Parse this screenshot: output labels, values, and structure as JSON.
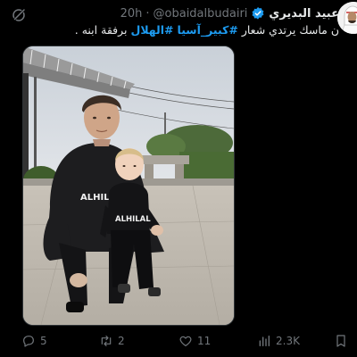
{
  "author": {
    "display_name": "عبيد البديري",
    "handle": "@obaidalbudairi",
    "separator": "·",
    "time": "20h"
  },
  "tweet": {
    "text_before": "ن ماسك يرتدي شعار ",
    "hashtag_1": "#كبير_آسيا",
    "hashtag_2": "#الهلال",
    "text_after": " برفقة ابنه ."
  },
  "media": {
    "shirt_text_adult": "ALHILAL",
    "shirt_text_child": "ALHILAL"
  },
  "actions": {
    "replies": "5",
    "reposts": "2",
    "likes": "11",
    "views": "2.3K"
  },
  "icons": {
    "reply": "reply-icon",
    "repost": "repost-icon",
    "like": "heart-icon",
    "views": "views-icon",
    "bookmark": "bookmark-icon",
    "grok": "grok-icon",
    "verified": "verified-badge-icon"
  },
  "colors": {
    "background": "#000000",
    "text": "#e7e9ea",
    "muted": "#71767b",
    "accent": "#1d9bf0"
  }
}
